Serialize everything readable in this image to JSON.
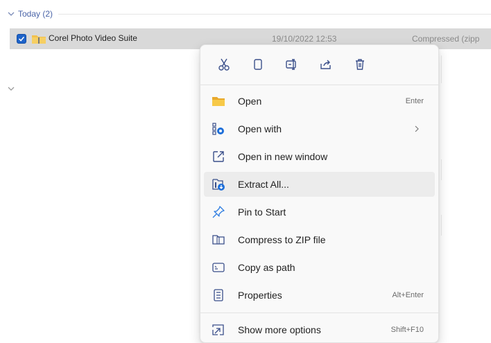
{
  "explorer": {
    "group_label": "Today (2)",
    "file": {
      "name": "Corel Photo Video Suite",
      "date": "19/10/2022 12:53",
      "type": "Compressed (zipp"
    }
  },
  "context_menu": {
    "quick_actions": [
      {
        "icon": "cut-icon"
      },
      {
        "icon": "copy-icon"
      },
      {
        "icon": "rename-icon"
      },
      {
        "icon": "share-icon"
      },
      {
        "icon": "delete-icon"
      }
    ],
    "items": [
      {
        "label": "Open",
        "shortcut": "Enter",
        "icon": "folder-open-icon"
      },
      {
        "label": "Open with",
        "shortcut": "",
        "icon": "open-with-icon",
        "submenu": true
      },
      {
        "label": "Open in new window",
        "shortcut": "",
        "icon": "new-window-icon"
      },
      {
        "label": "Extract All...",
        "shortcut": "",
        "icon": "extract-icon",
        "highlighted": true
      },
      {
        "label": "Pin to Start",
        "shortcut": "",
        "icon": "pin-icon"
      },
      {
        "label": "Compress to ZIP file",
        "shortcut": "",
        "icon": "zip-icon"
      },
      {
        "label": "Copy as path",
        "shortcut": "",
        "icon": "copy-path-icon"
      },
      {
        "label": "Properties",
        "shortcut": "Alt+Enter",
        "icon": "properties-icon"
      }
    ],
    "more": {
      "label": "Show more options",
      "shortcut": "Shift+F10",
      "icon": "more-options-icon"
    }
  },
  "colors": {
    "accent": "#1e63c9",
    "group_label": "#4a64a8",
    "menu_bg": "#f9f9f9",
    "selected_row": "#d9d9d9",
    "hover_item": "#ececec"
  }
}
